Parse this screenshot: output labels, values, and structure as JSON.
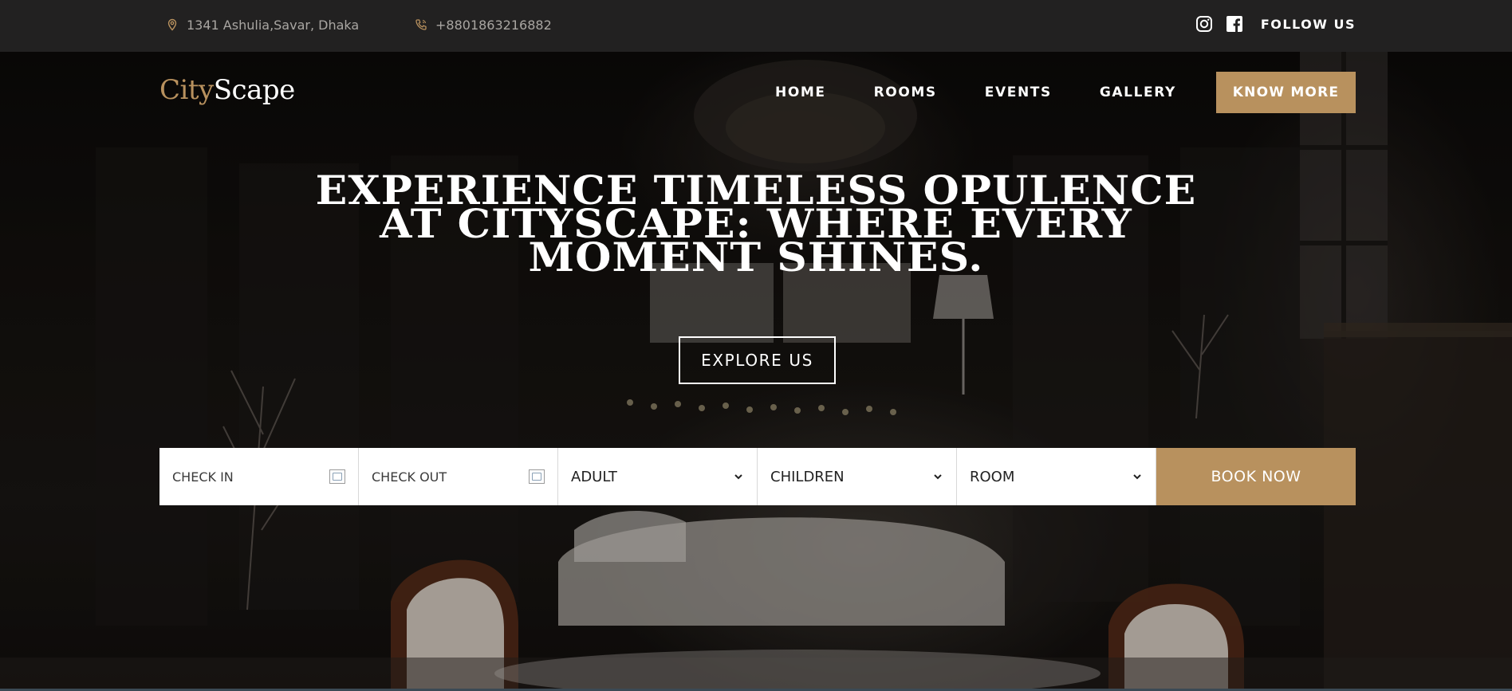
{
  "topbar": {
    "address": "1341 Ashulia,Savar, Dhaka",
    "phone": "+8801863216882",
    "follow_label": "FOLLOW US",
    "icons": [
      "map-pin-icon",
      "phone-icon",
      "instagram-icon",
      "facebook-icon"
    ]
  },
  "brand": {
    "logo_part1": "City",
    "logo_part2": "Scape",
    "accent_color": "#b8915e"
  },
  "nav": {
    "items": [
      {
        "label": "HOME"
      },
      {
        "label": "ROOMS"
      },
      {
        "label": "EVENTS"
      },
      {
        "label": "GALLERY"
      }
    ],
    "cta_label": "KNOW MORE"
  },
  "hero": {
    "headline_line1": "EXPERIENCE TIMELESS OPULENCE",
    "headline_line2": "AT CITYSCAPE: WHERE EVERY",
    "headline_line3": "MOMENT SHINES.",
    "explore_label": "EXPLORE US"
  },
  "booking": {
    "check_in_placeholder": "CHECK IN",
    "check_out_placeholder": "CHECK OUT",
    "adult_label": "ADULT",
    "children_label": "CHILDREN",
    "room_label": "ROOM",
    "book_label": "BOOK NOW"
  }
}
